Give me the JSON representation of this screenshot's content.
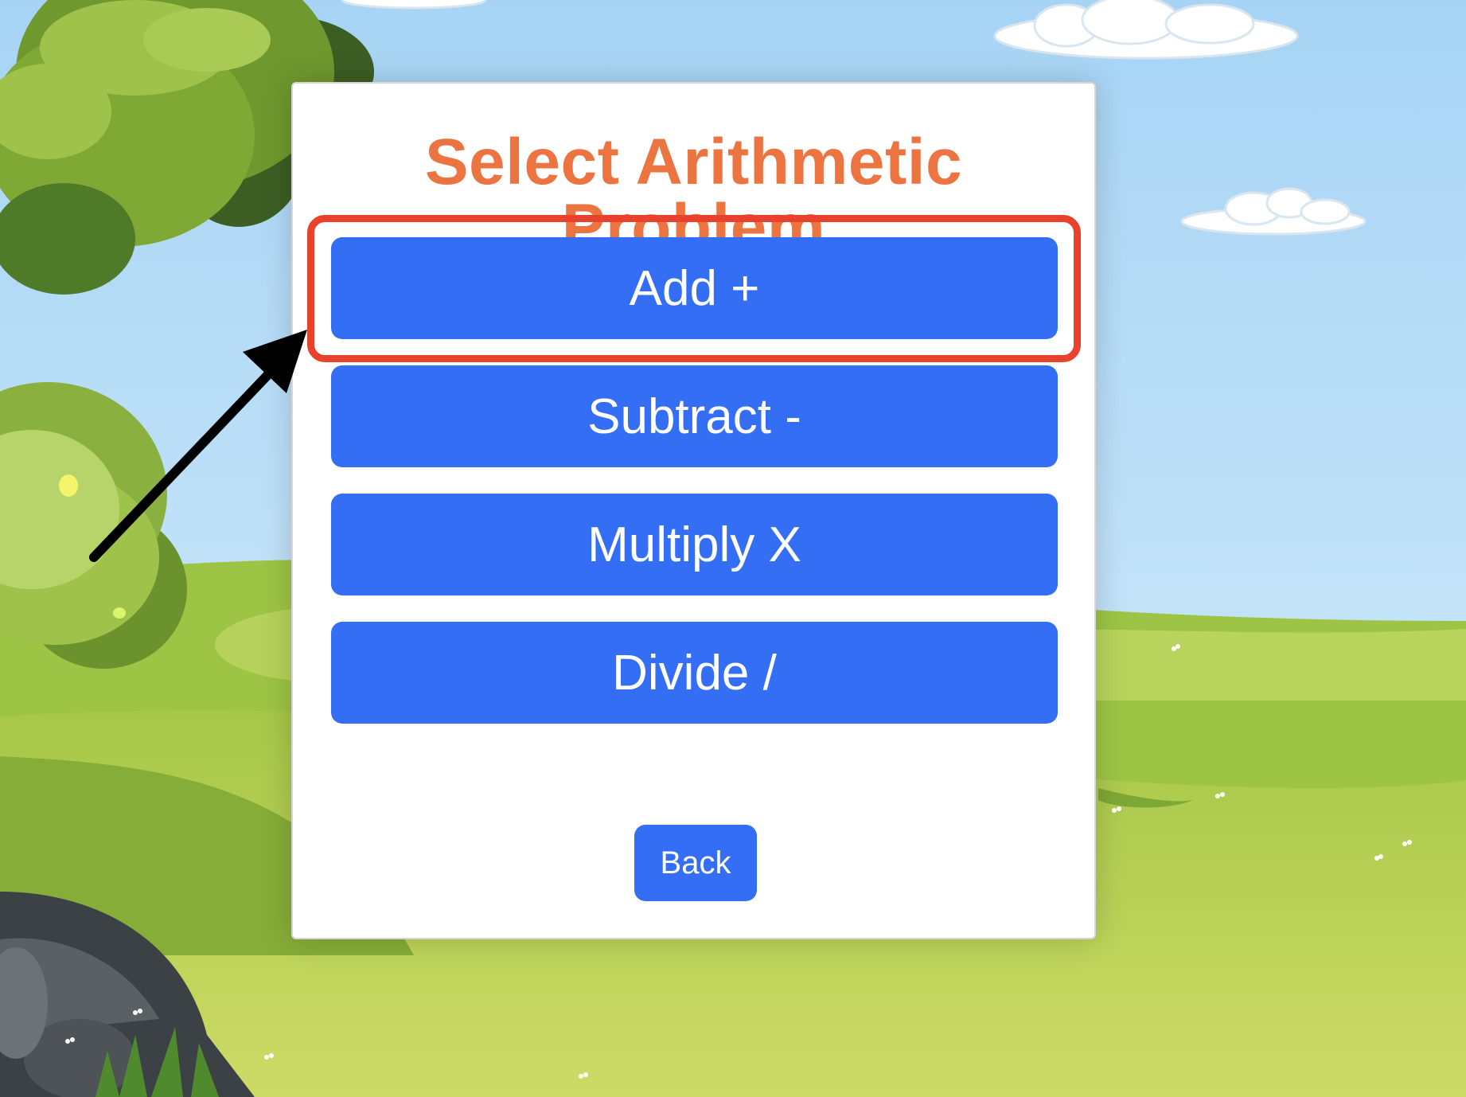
{
  "panel": {
    "title": "Select Arithmetic Problem",
    "buttons": [
      {
        "label": "Add +"
      },
      {
        "label": "Subtract -"
      },
      {
        "label": "Multiply X"
      },
      {
        "label": "Divide /"
      }
    ],
    "back_label": "Back"
  },
  "colors": {
    "title": "#ec7441",
    "button": "#336ef5",
    "button_text": "#ffffff",
    "highlight": "#e8412c",
    "arrow": "#000000",
    "sky": "#aed8f5",
    "grass": "#b9d25a"
  },
  "annotations": {
    "highlighted_button": "Add +"
  }
}
